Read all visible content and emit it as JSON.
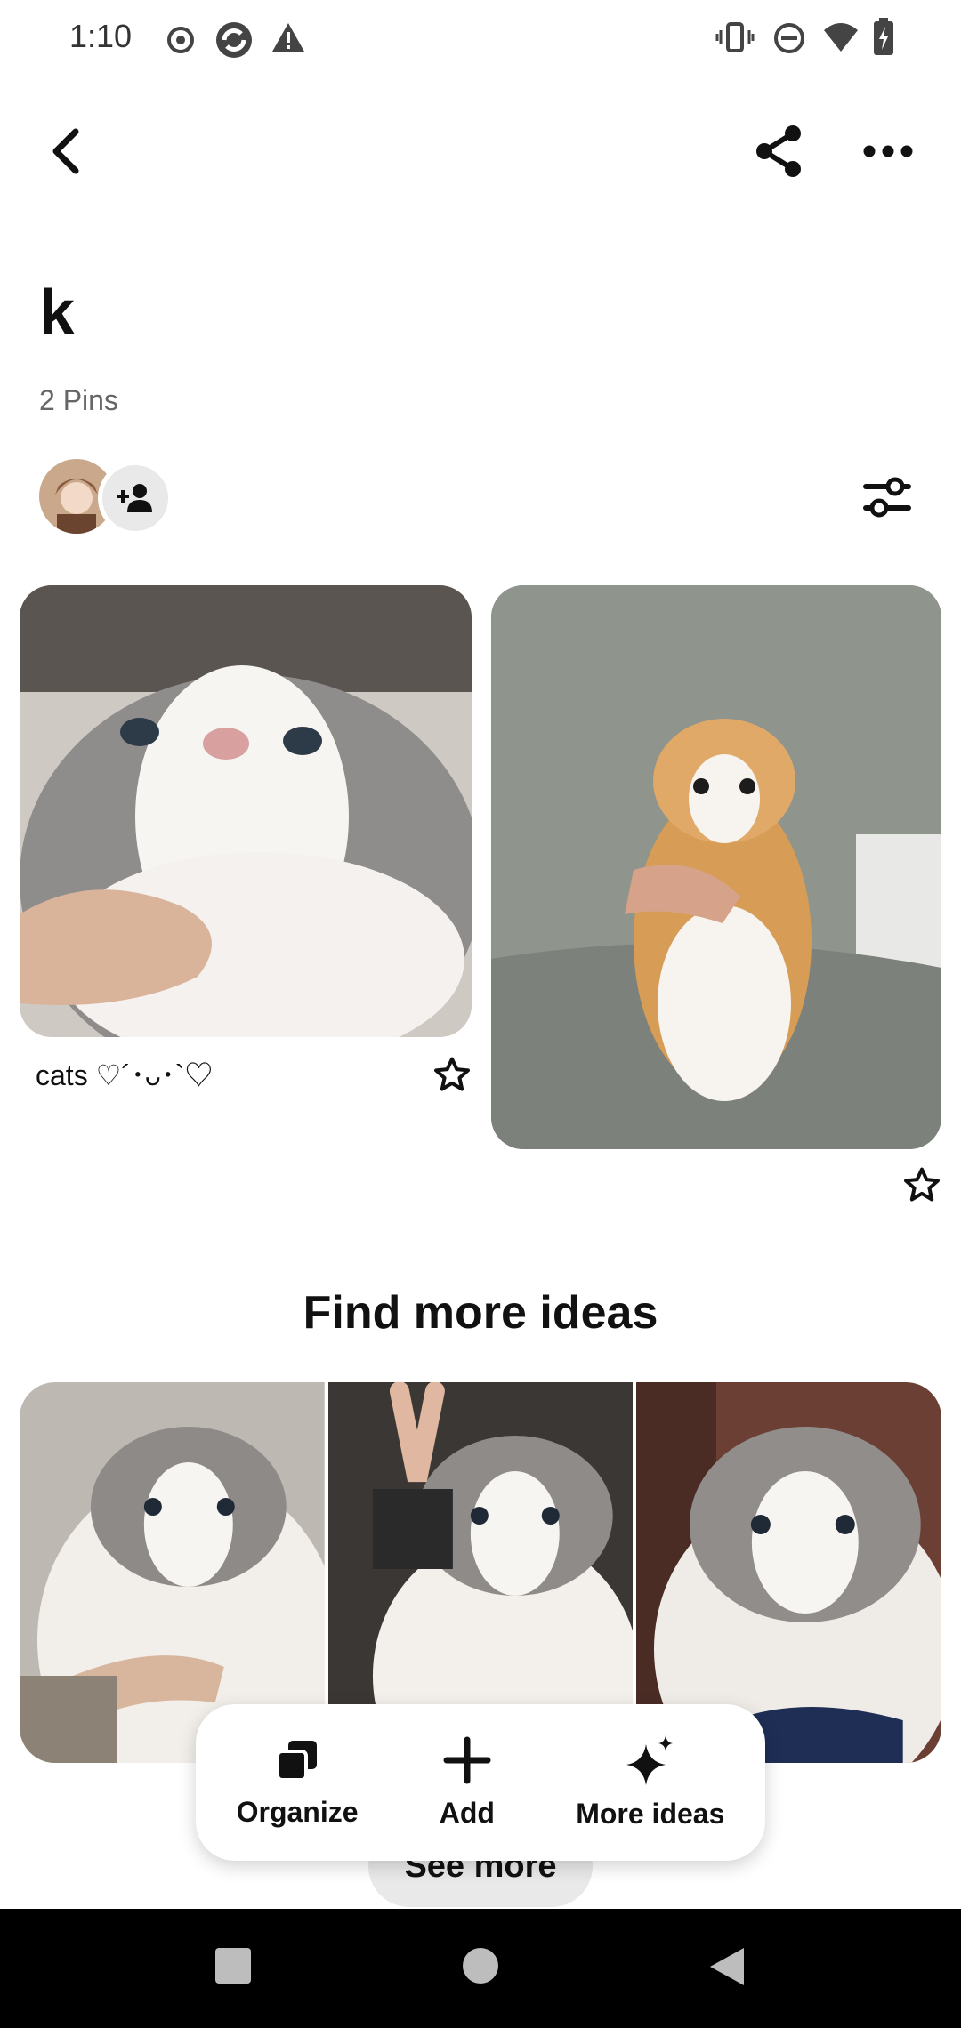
{
  "status_bar": {
    "time": "1:10"
  },
  "board": {
    "title": "k",
    "pin_count": "2 Pins"
  },
  "pins": [
    {
      "caption": "cats ♡´･ᴗ･`♡"
    },
    {
      "caption": ""
    }
  ],
  "section": {
    "find_more": "Find more ideas",
    "see_more": "See more"
  },
  "actions": {
    "organize": "Organize",
    "add": "Add",
    "more_ideas": "More ideas"
  },
  "icons": {
    "back": "chevron-left-icon",
    "share": "share-icon",
    "more": "more-horizontal-icon",
    "add_collaborator": "add-user-icon",
    "filter": "sliders-icon",
    "star": "star-outline-icon"
  }
}
